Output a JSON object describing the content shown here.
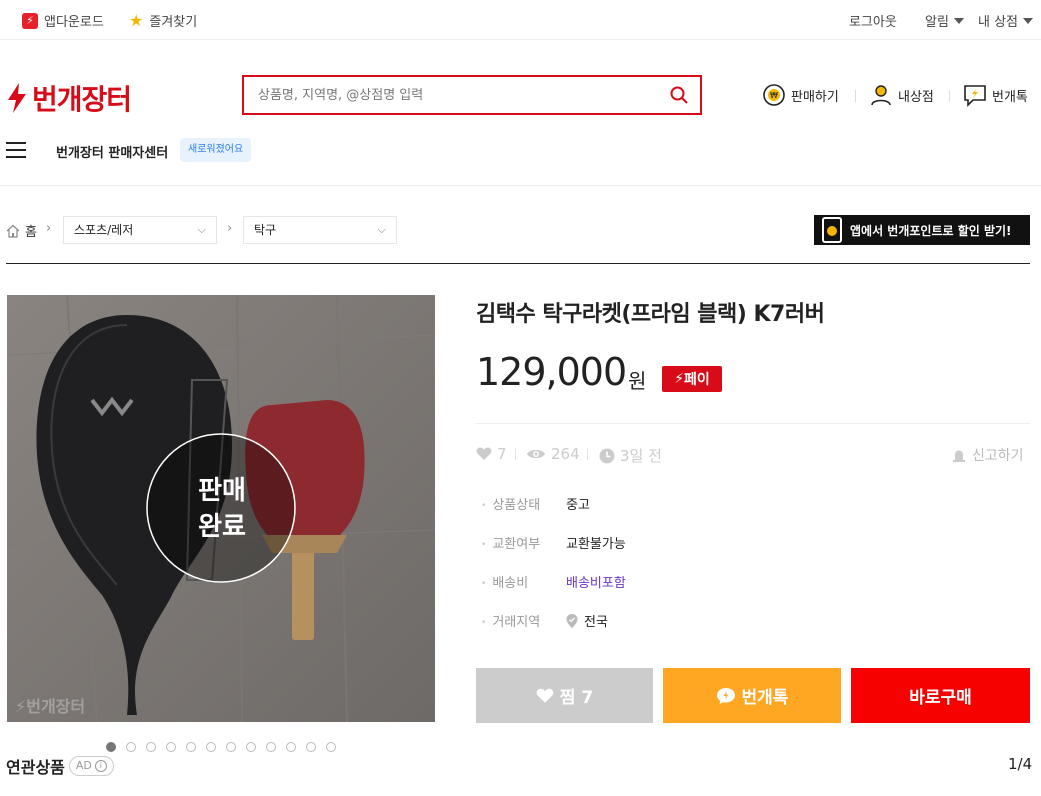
{
  "topbar": {
    "app_download": "앱다운로드",
    "favorites": "즐겨찾기",
    "logout": "로그아웃",
    "alerts": "알림",
    "my_store": "내 상점"
  },
  "header": {
    "logo": "번개장터",
    "search_placeholder": "상품명, 지역명, @상점명 입력",
    "sell": "판매하기",
    "my_shop": "내상점",
    "bungae_talk": "번개톡",
    "seller_center": "번개장터 판매자센터",
    "new_badge": "새로워졌어요"
  },
  "breadcrumb": {
    "home": "홈",
    "category1": "스포츠/레저",
    "category2": "탁구"
  },
  "banner": {
    "text": "앱에서 번개포인트로 할인 받기!"
  },
  "product": {
    "title": "김택수 탁구라켓(프라임 블랙) K7러버",
    "price": "129,000",
    "currency": "원",
    "pay_badge": "페이",
    "likes": "7",
    "views": "264",
    "time": "3일 전",
    "report": "신고하기",
    "sold_overlay_line1": "판매",
    "sold_overlay_line2": "완료",
    "watermark": "번개장터",
    "details": [
      {
        "label": "상품상태",
        "value": "중고"
      },
      {
        "label": "교환여부",
        "value": "교환불가능"
      },
      {
        "label": "배송비",
        "value": "배송비포함"
      },
      {
        "label": "거래지역",
        "value": "전국"
      }
    ]
  },
  "actions": {
    "like": "찜 7",
    "chat": "번개톡",
    "buy": "바로구매"
  },
  "image_dots": {
    "total": 12,
    "active": 1
  },
  "related": {
    "title": "연관상품",
    "ad": "AD",
    "pager": "1/4"
  },
  "colors": {
    "brand_red": "#d80c18",
    "chat_orange": "#ffa723",
    "buy_red": "#f70000",
    "shipping_link": "#6a36c9"
  }
}
